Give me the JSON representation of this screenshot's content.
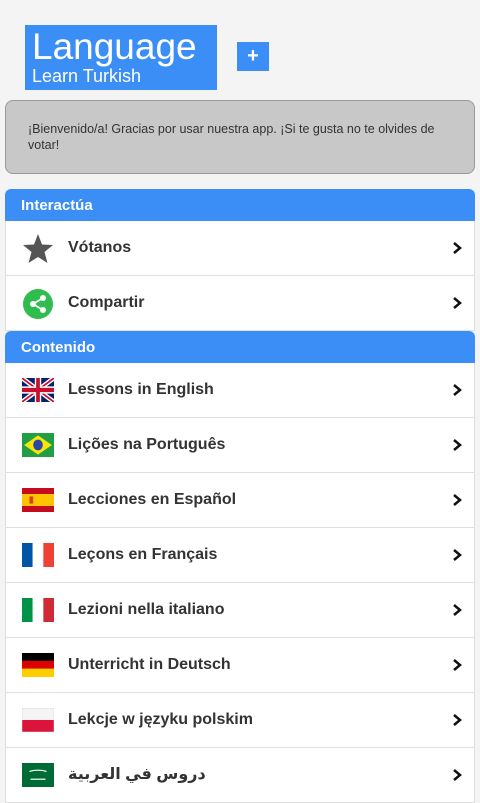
{
  "header": {
    "logo_title": "Language",
    "logo_subtitle": "Learn Turkish",
    "plus_label": "+"
  },
  "notice": {
    "text": "¡Bienvenido/a! Gracias por usar nuestra app. ¡Si te gusta no te olvides de votar!"
  },
  "interact": {
    "title": "Interactúa",
    "items": [
      {
        "label": "Vótanos",
        "icon": "star-icon"
      },
      {
        "label": "Compartir",
        "icon": "share-icon"
      }
    ]
  },
  "content": {
    "title": "Contenido",
    "items": [
      {
        "label": "Lessons in English",
        "icon": "uk-flag-icon"
      },
      {
        "label": "Lições na Português",
        "icon": "brazil-flag-icon"
      },
      {
        "label": "Lecciones en Español",
        "icon": "spain-flag-icon"
      },
      {
        "label": "Leçons en Français",
        "icon": "france-flag-icon"
      },
      {
        "label": "Lezioni nella italiano",
        "icon": "italy-flag-icon"
      },
      {
        "label": "Unterricht in Deutsch",
        "icon": "germany-flag-icon"
      },
      {
        "label": "Lekcje w języku polskim",
        "icon": "poland-flag-icon"
      },
      {
        "label": "دروس في العربية",
        "icon": "saudi-flag-icon"
      }
    ]
  },
  "colors": {
    "accent": "#3b8ef5",
    "share_green": "#2ebd4e"
  }
}
